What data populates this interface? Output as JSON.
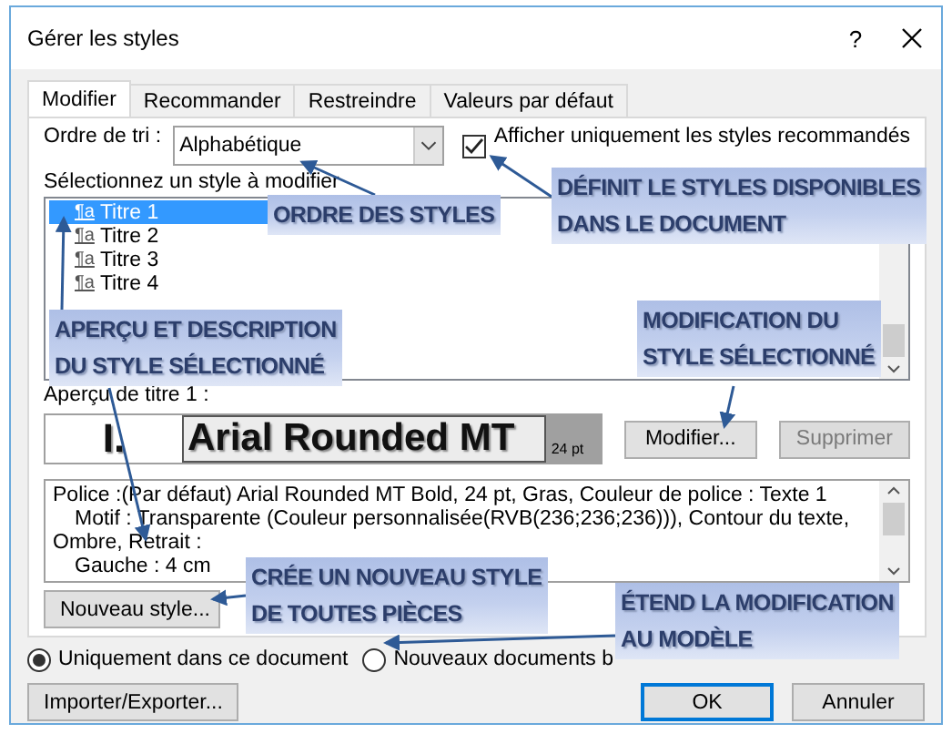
{
  "window": {
    "title": "Gérer les styles",
    "help": "?"
  },
  "tabs": [
    {
      "label": "Modifier",
      "selected": true
    },
    {
      "label": "Recommander",
      "selected": false
    },
    {
      "label": "Restreindre",
      "selected": false
    },
    {
      "label": "Valeurs par défaut",
      "selected": false
    }
  ],
  "sort": {
    "label": "Ordre de tri :",
    "value": "Alphabétique"
  },
  "recommended_only": {
    "label": "Afficher uniquement les styles recommandés",
    "checked": true
  },
  "style_list": {
    "label": "Sélectionnez un style à modifier",
    "items": [
      {
        "icon": "¶a",
        "name": "Titre 1",
        "selected": true
      },
      {
        "icon": "¶a",
        "name": "Titre 2",
        "selected": false
      },
      {
        "icon": "¶a",
        "name": "Titre 3",
        "selected": false
      },
      {
        "icon": "¶a",
        "name": "Titre 4",
        "selected": false
      }
    ]
  },
  "preview": {
    "label": "Aperçu de titre 1 :",
    "number": "I.",
    "sample": "Arial Rounded MT",
    "size": "24 pt"
  },
  "modify_button": {
    "label": "Modifier...",
    "disabled": false
  },
  "delete_button": {
    "label": "Supprimer",
    "disabled": true
  },
  "description": [
    {
      "text": "Police :(Par défaut) Arial Rounded MT Bold, 24 pt, Gras, Couleur de police : Texte 1",
      "indented": false
    },
    {
      "text": "Motif : Transparente (Couleur personnalisée(RVB(236;236;236))), Contour du texte,",
      "indented": true
    },
    {
      "text": "Ombre, Retrait :",
      "indented": false
    },
    {
      "text": "Gauche :  4 cm",
      "indented": true
    }
  ],
  "new_style_button": "Nouveau style...",
  "scope": [
    {
      "label": "Uniquement dans ce document",
      "selected": true
    },
    {
      "label": "Nouveaux documents b",
      "selected": false
    }
  ],
  "footer_buttons": [
    {
      "label": "Importer/Exporter...",
      "default": false
    },
    {
      "label": "OK",
      "default": true
    },
    {
      "label": "Annuler",
      "default": false
    }
  ],
  "callouts": [
    {
      "text": "ORDRE DES STYLES"
    },
    {
      "text": "DÉFINIT LE STYLES DISPONIBLES\nDANS LE DOCUMENT"
    },
    {
      "text": "APERÇU ET DESCRIPTION\nDU STYLE SÉLECTIONNÉ"
    },
    {
      "text": "MODIFICATION DU\nSTYLE SÉLECTIONNÉ"
    },
    {
      "text": "CRÉE UN NOUVEAU STYLE\nDE TOUTES PIÈCES"
    },
    {
      "text": "ÉTEND LA MODIFICATION\nAU MODÈLE"
    }
  ]
}
